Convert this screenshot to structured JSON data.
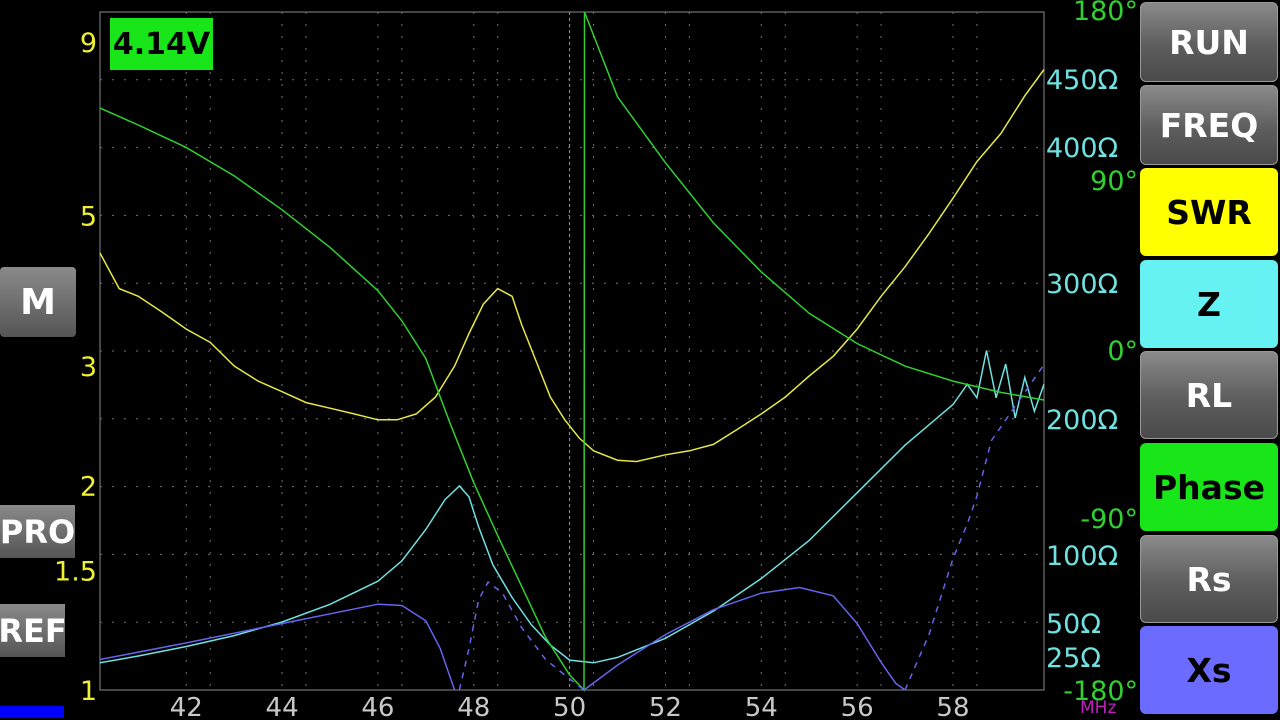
{
  "voltage": "4.14V",
  "unit_label": "MHz",
  "left_buttons": {
    "m": "M",
    "pro": "PRO",
    "ref": "REF"
  },
  "right_buttons": [
    {
      "label": "RUN",
      "bg": "gray"
    },
    {
      "label": "FREQ",
      "bg": "gray"
    },
    {
      "label": "SWR",
      "bg": "#ffff00"
    },
    {
      "label": "Z",
      "bg": "#66f2f2"
    },
    {
      "label": "RL",
      "bg": "gray"
    },
    {
      "label": "Phase",
      "bg": "#19e619"
    },
    {
      "label": "Rs",
      "bg": "gray"
    },
    {
      "label": "Xs",
      "bg": "#6b6bff"
    }
  ],
  "colors": {
    "swr": "#e6e645",
    "z": "#70e0e0",
    "phase": "#30d030",
    "xs": "#6464ee",
    "grid": "#707070"
  },
  "chart_data": {
    "type": "line",
    "x_range": [
      40.2,
      59.9
    ],
    "x_ticks": [
      "42",
      "44",
      "46",
      "48",
      "50",
      "52",
      "54",
      "56",
      "58"
    ],
    "swr_axis": {
      "ticks": [
        {
          "v": 9,
          "label": "9"
        },
        {
          "v": 5,
          "label": "5"
        },
        {
          "v": 3,
          "label": "3"
        },
        {
          "v": 2,
          "label": "2"
        },
        {
          "v": 1.5,
          "label": "1.5"
        },
        {
          "v": 1,
          "label": "1"
        }
      ]
    },
    "phase_axis": {
      "range": [
        -180,
        180
      ],
      "ticks": [
        {
          "v": 180,
          "label": "180°"
        },
        {
          "v": 90,
          "label": "90°"
        },
        {
          "v": 0,
          "label": "0°"
        },
        {
          "v": -90,
          "label": "-90°"
        },
        {
          "v": -180,
          "label": "-180°"
        }
      ]
    },
    "z_axis": {
      "ticks": [
        {
          "v": 450,
          "label": "450Ω"
        },
        {
          "v": 400,
          "label": "400Ω"
        },
        {
          "v": 300,
          "label": "300Ω"
        },
        {
          "v": 200,
          "label": "200Ω"
        },
        {
          "v": 100,
          "label": "100Ω"
        },
        {
          "v": 50,
          "label": "50Ω"
        },
        {
          "v": 25,
          "label": "25Ω"
        }
      ]
    },
    "series": [
      {
        "key": "swr",
        "x": [
          40.2,
          40.6,
          41,
          41.5,
          42,
          42.5,
          43,
          43.5,
          44,
          44.5,
          45,
          45.5,
          46,
          46.4,
          46.8,
          47.2,
          47.6,
          47.9,
          48.2,
          48.5,
          48.8,
          49,
          49.3,
          49.6,
          49.9,
          50.2,
          50.5,
          51,
          51.4,
          52,
          52.5,
          53,
          53.5,
          54,
          54.5,
          55,
          55.5,
          56,
          56.5,
          57,
          57.5,
          58,
          58.5,
          59,
          59.5,
          59.9
        ],
        "y": [
          4.4,
          3.9,
          3.8,
          3.6,
          3.4,
          3.25,
          3.0,
          2.85,
          2.75,
          2.65,
          2.6,
          2.55,
          2.5,
          2.5,
          2.55,
          2.7,
          3.0,
          3.35,
          3.7,
          3.9,
          3.8,
          3.45,
          3.05,
          2.7,
          2.5,
          2.35,
          2.25,
          2.18,
          2.17,
          2.22,
          2.25,
          2.3,
          2.42,
          2.55,
          2.7,
          2.9,
          3.1,
          3.4,
          3.8,
          4.2,
          4.7,
          5.3,
          6.0,
          6.6,
          7.5,
          8.2
        ]
      },
      {
        "key": "z",
        "x": [
          40.2,
          41,
          42,
          43,
          44,
          45,
          46,
          46.5,
          47,
          47.4,
          47.7,
          47.9,
          48.1,
          48.4,
          48.8,
          49.2,
          49.6,
          50,
          50.5,
          51,
          52,
          53,
          54,
          55,
          56,
          57,
          57.5,
          58,
          58.3,
          58.5,
          58.7,
          58.9,
          59.1,
          59.3,
          59.5,
          59.7,
          59.9
        ],
        "y": [
          20,
          25,
          32,
          40,
          50,
          63,
          80,
          95,
          118,
          140,
          150,
          142,
          120,
          92,
          68,
          48,
          33,
          22,
          20,
          24,
          38,
          58,
          82,
          110,
          145,
          180,
          195,
          210,
          225,
          215,
          250,
          215,
          240,
          200,
          230,
          205,
          225
        ]
      },
      {
        "key": "phase",
        "x": [
          40.2,
          41,
          42,
          43,
          44,
          45,
          46,
          46.5,
          47,
          47.5,
          48,
          48.5,
          49,
          49.5,
          50,
          50.3,
          50.31,
          51,
          52,
          53,
          54,
          55,
          56,
          57,
          58,
          59,
          59.9
        ],
        "y": [
          129,
          120,
          108,
          93,
          75,
          55,
          32,
          16,
          -4,
          -38,
          -70,
          -98,
          -125,
          -152,
          -172,
          -180,
          180,
          135,
          100,
          68,
          42,
          20,
          4,
          -8,
          -16,
          -22,
          -26
        ]
      },
      {
        "key": "xs",
        "x": [
          40.2,
          42,
          44,
          46,
          46.5,
          47,
          47.3,
          47.5,
          47.6
        ],
        "y": [
          22,
          34,
          48,
          62,
          61,
          50,
          30,
          10,
          0
        ]
      },
      {
        "key": "xs",
        "x": [
          50.3,
          51,
          52,
          53,
          54,
          54.8,
          55.5,
          56,
          56.5,
          56.8,
          57
        ],
        "y": [
          0,
          18,
          40,
          58,
          70,
          74,
          68,
          48,
          20,
          5,
          0
        ]
      }
    ],
    "xs_dashed": [
      {
        "x": [
          47.7,
          47.9,
          48.1,
          48.3,
          48.6,
          49,
          49.5,
          50,
          50.3
        ],
        "y": [
          0,
          30,
          65,
          78,
          70,
          45,
          22,
          8,
          0
        ]
      },
      {
        "x": [
          57,
          57.5,
          58,
          58.3,
          58.5,
          58.8,
          59.1,
          59.5,
          59.9
        ],
        "y": [
          0,
          40,
          95,
          120,
          140,
          180,
          195,
          215,
          235
        ]
      }
    ]
  }
}
